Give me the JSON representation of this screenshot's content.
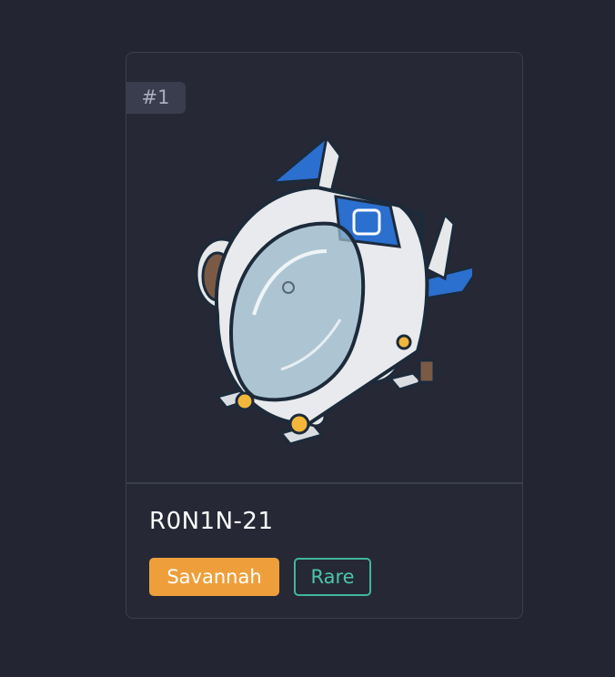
{
  "card": {
    "rank": "#1",
    "name": "R0N1N-21",
    "image_icon": "hovercraft-pod-robot",
    "tags": {
      "class": "Savannah",
      "rarity": "Rare"
    }
  },
  "colors": {
    "background": "#232532",
    "card": "#262835",
    "class_tag": "#ee9f3b",
    "rarity_tag": "#3fb89b"
  }
}
